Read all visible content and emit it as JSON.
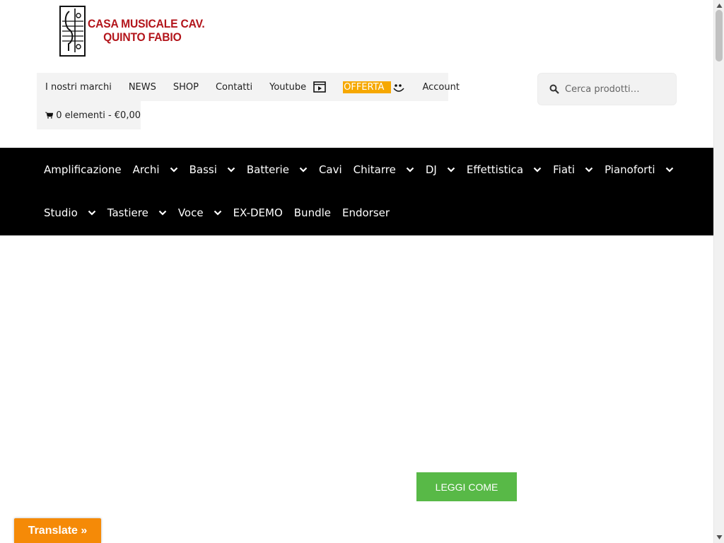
{
  "logo": {
    "line1": "CASA MUSICALE CAV.",
    "line2": "QUINTO FABIO",
    "color": "#b3151b"
  },
  "topnav": {
    "items": [
      {
        "label": "I nostri marchi"
      },
      {
        "label": "NEWS"
      },
      {
        "label": "SHOP"
      },
      {
        "label": "Contatti"
      },
      {
        "label": "Youtube",
        "icon": "video-icon"
      },
      {
        "label": "OFFERTA",
        "icon": "smile-icon",
        "badge_color": "#f6a800"
      },
      {
        "label": "Account"
      }
    ],
    "cart": {
      "label": "0 elementi - €0,00",
      "icon": "cart-icon"
    }
  },
  "search": {
    "placeholder": "Cerca prodotti…",
    "icon": "search-icon"
  },
  "mainnav": {
    "row1": [
      {
        "label": "Amplificazione",
        "dropdown": false
      },
      {
        "label": "Archi",
        "dropdown": true
      },
      {
        "label": "Bassi",
        "dropdown": true
      },
      {
        "label": "Batterie",
        "dropdown": true
      },
      {
        "label": "Cavi",
        "dropdown": false
      },
      {
        "label": "Chitarre",
        "dropdown": true
      },
      {
        "label": "DJ",
        "dropdown": true
      },
      {
        "label": "Effettistica",
        "dropdown": true
      },
      {
        "label": "Fiati",
        "dropdown": true
      },
      {
        "label": "Pianoforti",
        "dropdown": true
      }
    ],
    "row2": [
      {
        "label": "Studio",
        "dropdown": true
      },
      {
        "label": "Tastiere",
        "dropdown": true
      },
      {
        "label": "Voce",
        "dropdown": true
      },
      {
        "label": "EX-DEMO",
        "dropdown": false
      },
      {
        "label": "Bundle",
        "dropdown": false
      },
      {
        "label": "Endorser",
        "dropdown": false
      }
    ]
  },
  "content": {
    "read_more_label": "LEGGI COME",
    "read_more_color": "#58b947"
  },
  "translate": {
    "label": "Translate »",
    "color": "#f58a07"
  }
}
